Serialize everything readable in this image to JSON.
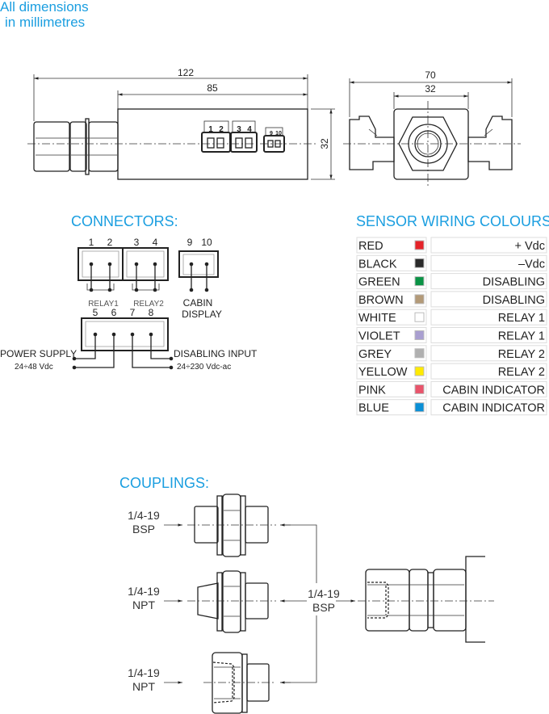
{
  "note": {
    "line1": "All dimensions",
    "line2": "in millimetres"
  },
  "drawing_side": {
    "dim_total": "122",
    "dim_body": "85",
    "dim_height": "32",
    "connector_labels": [
      "1",
      "2",
      "3",
      "4",
      "9",
      "10"
    ]
  },
  "drawing_front": {
    "dim_total": "70",
    "dim_body": "32"
  },
  "connectors": {
    "title": "CONNECTORS:",
    "pins_top": [
      "1",
      "2",
      "3",
      "4",
      "9",
      "10"
    ],
    "pins_bottom": [
      "5",
      "6",
      "7",
      "8"
    ],
    "relay1": "RELAY1",
    "relay2": "RELAY2",
    "cabin_line1": "CABIN",
    "cabin_line2": "DISPLAY",
    "power_supply": "POWER SUPPLY",
    "power_voltage": "24÷48 Vdc",
    "disabling_input": "DISABLING INPUT",
    "disabling_voltage": "24÷230 Vdc-ac"
  },
  "wiring": {
    "title": "SENSOR WIRING COLOURS",
    "rows": [
      {
        "colour": "RED",
        "swatch": "#e52329",
        "function": "+ Vdc"
      },
      {
        "colour": "BLACK",
        "swatch": "#2a2a2a",
        "function": "–Vdc"
      },
      {
        "colour": "GREEN",
        "swatch": "#0a9345",
        "function": "DISABLING"
      },
      {
        "colour": "BROWN",
        "swatch": "#b39a78",
        "function": "DISABLING"
      },
      {
        "colour": "WHITE",
        "swatch": "#ffffff",
        "function": "RELAY 1"
      },
      {
        "colour": "VIOLET",
        "swatch": "#a99fd0",
        "function": "RELAY 1"
      },
      {
        "colour": "GREY",
        "swatch": "#b0b0b0",
        "function": "RELAY 2"
      },
      {
        "colour": "YELLOW",
        "swatch": "#ffea00",
        "function": "RELAY 2"
      },
      {
        "colour": "PINK",
        "swatch": "#e9546b",
        "function": "CABIN INDICATOR"
      },
      {
        "colour": "BLUE",
        "swatch": "#0a8fd6",
        "function": "CABIN INDICATOR"
      }
    ]
  },
  "couplings": {
    "title": "COUPLINGS:",
    "items": [
      {
        "size": "1/4-19",
        "thread": "BSP"
      },
      {
        "size": "1/4-19",
        "thread": "NPT"
      },
      {
        "size": "1/4-19",
        "thread": "NPT"
      }
    ],
    "sensor_port": {
      "size": "1/4-19",
      "thread": "BSP"
    }
  },
  "colors": {
    "accent": "#1a9ee0"
  }
}
